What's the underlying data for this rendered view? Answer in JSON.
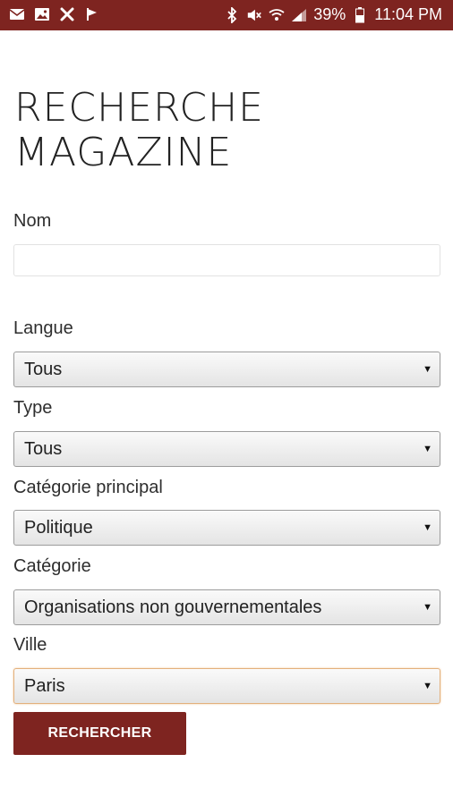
{
  "status_bar": {
    "time": "11:04 PM",
    "battery_percent": "39%",
    "left_icons": [
      "mail-icon",
      "image-icon",
      "x-app-icon",
      "flag-icon"
    ],
    "right_icons": [
      "bluetooth-icon",
      "mute-icon",
      "wifi-icon",
      "signal-icon",
      "battery-icon"
    ]
  },
  "page": {
    "title_line1": "RECHERCHE",
    "title_line2": "MAGAZINE"
  },
  "form": {
    "nom_label": "Nom",
    "nom_value": "",
    "langue_label": "Langue",
    "langue_value": "Tous",
    "type_label": "Type",
    "type_value": "Tous",
    "categorie_principal_label": "Catégorie principal",
    "categorie_principal_value": "Politique",
    "categorie_label": "Catégorie",
    "categorie_value": "Organisations non gouvernementales",
    "ville_label": "Ville",
    "ville_value": "Paris",
    "submit_label": "RECHERCHER"
  },
  "colors": {
    "brand": "#7e2420",
    "focus_border": "#e3b07c"
  }
}
